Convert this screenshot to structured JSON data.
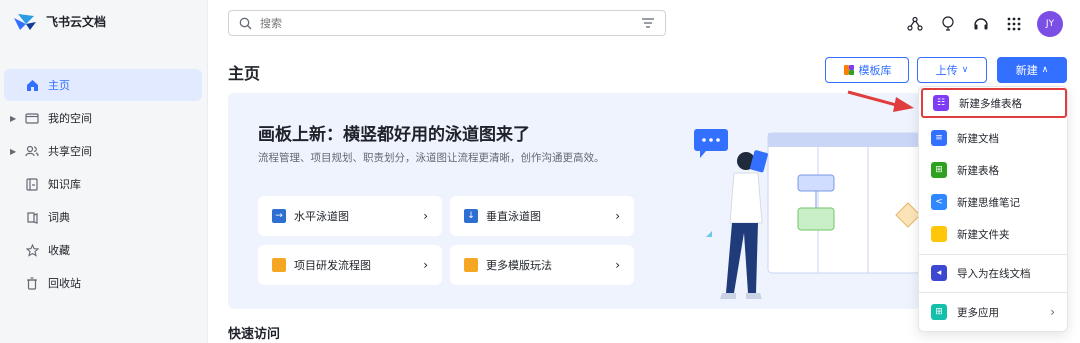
{
  "app": {
    "name": "飞书云文档"
  },
  "sidebar": {
    "items": [
      {
        "label": "主页",
        "icon": "home-icon"
      },
      {
        "label": "我的空间",
        "icon": "folder-icon"
      },
      {
        "label": "共享空间",
        "icon": "users-icon"
      },
      {
        "label": "知识库",
        "icon": "book-icon"
      },
      {
        "label": "词典",
        "icon": "dictionary-icon"
      },
      {
        "label": "收藏",
        "icon": "star-icon"
      },
      {
        "label": "回收站",
        "icon": "trash-icon"
      }
    ]
  },
  "search": {
    "placeholder": "搜索"
  },
  "user": {
    "initials": "JY"
  },
  "header": {
    "title": "主页",
    "template_label": "模板库",
    "upload_label": "上传",
    "new_label": "新建"
  },
  "banner": {
    "title": "画板上新：横竖都好用的泳道图来了",
    "subtitle": "流程管理、项目规划、职责划分，泳道图让流程更清晰，创作沟通更高效。",
    "cards": [
      {
        "label": "水平泳道图"
      },
      {
        "label": "垂直泳道图"
      },
      {
        "label": "项目研发流程图"
      },
      {
        "label": "更多模版玩法"
      }
    ]
  },
  "quick_access": {
    "title": "快速访问"
  },
  "new_menu": {
    "items": [
      {
        "label": "新建多维表格",
        "color": "#7f3bf5"
      },
      {
        "label": "新建文档",
        "color": "#3370ff"
      },
      {
        "label": "新建表格",
        "color": "#2ea121"
      },
      {
        "label": "新建思维笔记",
        "color": "#2f88ff"
      },
      {
        "label": "新建文件夹",
        "color": "#ffc60a"
      },
      {
        "label": "导入为在线文档",
        "color": "#3e47d1"
      },
      {
        "label": "更多应用",
        "color": "#14c0a9"
      }
    ]
  },
  "colors": {
    "accent": "#3370ff",
    "highlight": "#e03e3e"
  }
}
